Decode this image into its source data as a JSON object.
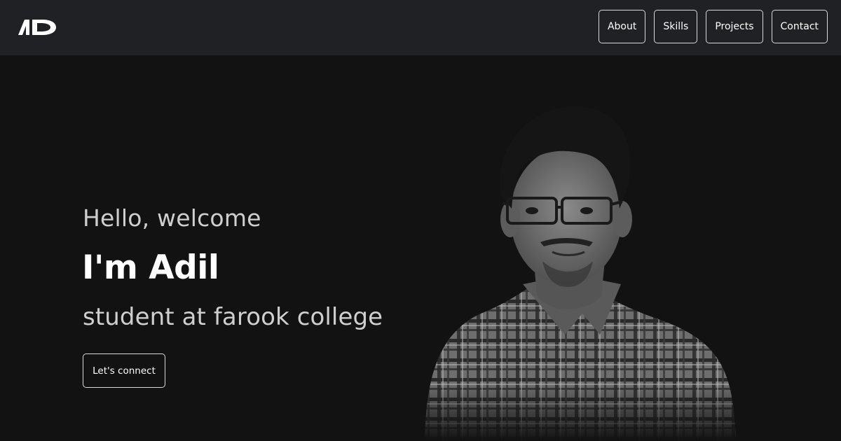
{
  "nav": {
    "logo_text": "AD",
    "links": [
      {
        "label": "About"
      },
      {
        "label": "Skills"
      },
      {
        "label": "Projects"
      },
      {
        "label": "Contact"
      }
    ]
  },
  "hero": {
    "greeting": "Hello, welcome",
    "name": "I'm Adil",
    "subtitle": "student at farook college",
    "cta_label": "Let's connect"
  },
  "colors": {
    "background": "#121213",
    "navbar": "#202124",
    "muted_text": "#cfcfcf",
    "border": "#d9d9d9"
  }
}
